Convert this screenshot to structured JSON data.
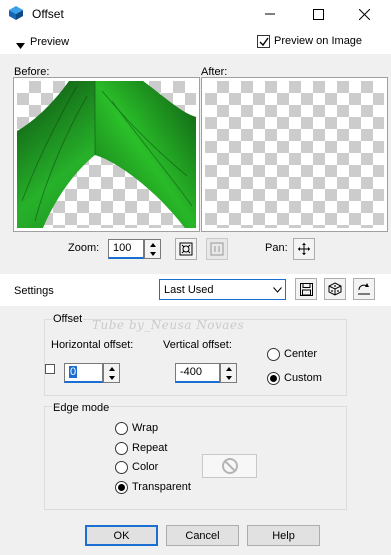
{
  "window": {
    "title": "Offset",
    "app_icon": "paintshop-pro-icon",
    "controls": [
      "minimize-icon",
      "maximize-icon",
      "close-icon"
    ]
  },
  "preview": {
    "toggle_label": "Preview",
    "preview_on_image_label": "Preview on Image",
    "preview_on_image_checked": true,
    "before_label": "Before:",
    "after_label": "After:"
  },
  "zoom": {
    "label": "Zoom:",
    "value": "100",
    "pan_label": "Pan:"
  },
  "settings": {
    "label": "Settings",
    "preset_value": "Last Used"
  },
  "offset": {
    "group_title": "Offset",
    "watermark": "Tube by_Neusa Novaes",
    "horizontal_label": "Horizontal offset:",
    "horizontal_value": "0",
    "vertical_label": "Vertical offset:",
    "vertical_value": "-400",
    "center_label": "Center",
    "custom_label": "Custom",
    "selected": "Custom"
  },
  "edge_mode": {
    "group_title": "Edge mode",
    "options": [
      "Wrap",
      "Repeat",
      "Color",
      "Transparent"
    ],
    "selected": "Transparent"
  },
  "buttons": {
    "ok": "OK",
    "cancel": "Cancel",
    "help": "Help"
  },
  "colors": {
    "accent": "#1a6fd1",
    "leaf_dark": "#0f5a12",
    "leaf_light": "#2fbf2a"
  }
}
